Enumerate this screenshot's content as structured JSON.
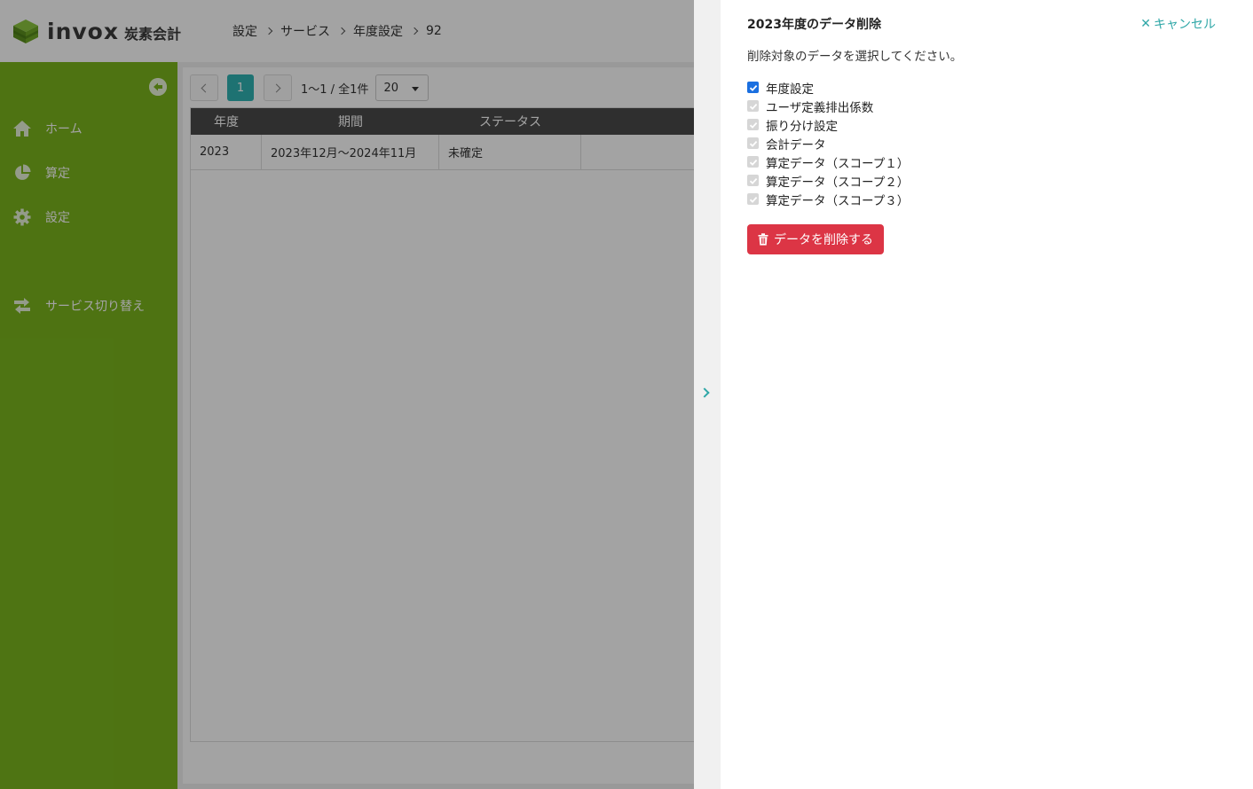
{
  "header": {
    "logo_text": "invox",
    "logo_sub": "炭素会計",
    "breadcrumb": [
      "設定",
      "サービス",
      "年度設定",
      "92"
    ]
  },
  "sidebar": {
    "items": [
      {
        "label": "ホーム",
        "icon": "home-icon"
      },
      {
        "label": "算定",
        "icon": "pie-chart-icon"
      },
      {
        "label": "設定",
        "icon": "gear-icon"
      },
      {
        "label": "サービス切り替え",
        "icon": "switch-icon"
      }
    ]
  },
  "pager": {
    "current_page": "1",
    "info": "1〜1 / 全1件",
    "per_page": "20"
  },
  "table": {
    "headers": [
      "年度",
      "期間",
      "ステータス"
    ],
    "rows": [
      {
        "year": "2023",
        "period": "2023年12月〜2024年11月",
        "status": "未確定"
      }
    ]
  },
  "drawer": {
    "title": "2023年度のデータ削除",
    "cancel_label": "キャンセル",
    "description": "削除対象のデータを選択してください。",
    "options": [
      {
        "label": "年度設定",
        "checked": true,
        "enabled": true
      },
      {
        "label": "ユーザ定義排出係数",
        "checked": true,
        "enabled": false
      },
      {
        "label": "振り分け設定",
        "checked": true,
        "enabled": false
      },
      {
        "label": "会計データ",
        "checked": true,
        "enabled": false
      },
      {
        "label": "算定データ（スコープ１）",
        "checked": true,
        "enabled": false
      },
      {
        "label": "算定データ（スコープ２）",
        "checked": true,
        "enabled": false
      },
      {
        "label": "算定データ（スコープ３）",
        "checked": true,
        "enabled": false
      }
    ],
    "delete_label": "データを削除する"
  },
  "colors": {
    "sidebar_green": "#7ab51d",
    "accent_teal": "#2fb3b3",
    "danger_red": "#dc3545",
    "checkbox_blue": "#1a6fe0"
  }
}
